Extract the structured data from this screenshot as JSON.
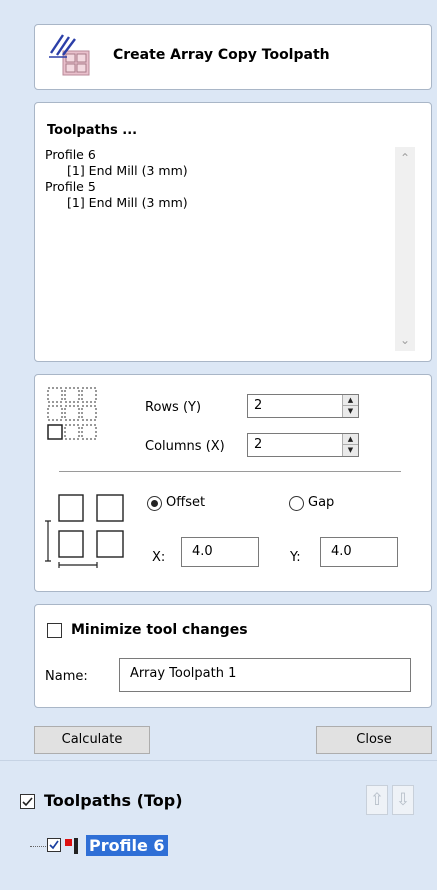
{
  "header": {
    "title": "Create Array Copy Toolpath",
    "icon": "array-copy-icon"
  },
  "toolpaths": {
    "heading": "Toolpaths ...",
    "items": [
      {
        "name": "Profile 6",
        "tool": "[1] End Mill (3 mm)"
      },
      {
        "name": "Profile 5",
        "tool": "[1] End Mill (3 mm)"
      }
    ]
  },
  "array": {
    "rows_label": "Rows (Y)",
    "rows_value": "2",
    "columns_label": "Columns (X)",
    "columns_value": "2",
    "offset_label": "Offset",
    "gap_label": "Gap",
    "selected_mode": "Offset",
    "x_label": "X:",
    "x_value": "4.0",
    "y_label": "Y:",
    "y_value": "4.0"
  },
  "options": {
    "minimize_label": "Minimize tool changes",
    "minimize_checked": false,
    "name_label": "Name:",
    "name_value": "Array Toolpath 1"
  },
  "buttons": {
    "calculate": "Calculate",
    "close": "Close"
  },
  "tree": {
    "title": "Toolpaths (Top)",
    "title_checked": true,
    "item": "Profile 6",
    "item_checked": true
  },
  "colors": {
    "panel_bg": "#dce7f5",
    "selection": "#2f6fd6"
  }
}
